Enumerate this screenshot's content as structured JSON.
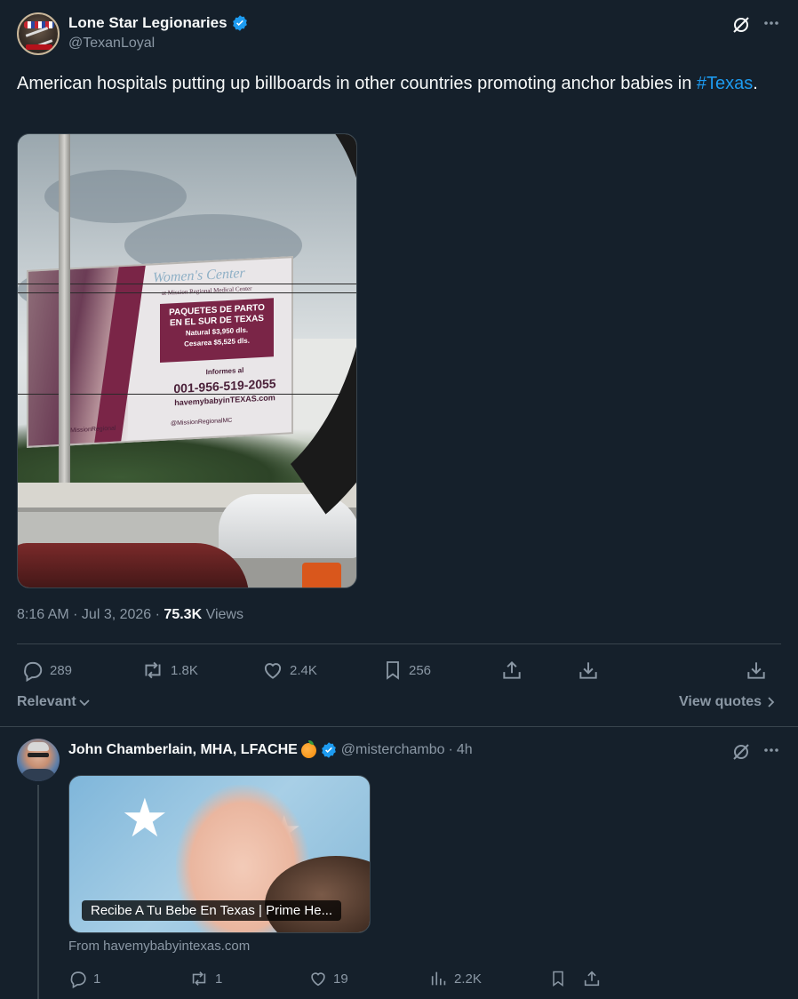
{
  "post": {
    "author_name": "Lone Star Legionaries",
    "author_handle": "@TexanLoyal",
    "text_before": "American hospitals putting up billboards in other countries promoting anchor babies in ",
    "hashtag": "#Texas",
    "text_after": ".",
    "photo": {
      "billboard_brand": "Women's Center",
      "billboard_sub": "at Mission Regional Medical Center",
      "billboard_box_line1": "PAQUETES DE PARTO",
      "billboard_box_line2": "EN EL SUR DE TEXAS",
      "billboard_natural": "Natural $3,950 dls.",
      "billboard_cesarea": "Cesarea $5,525 dls.",
      "billboard_informes": "Informes al",
      "billboard_phone": "001-956-519-2055",
      "billboard_url": "havemybabyinTEXAS.com",
      "billboard_social1": "@MissionRegional",
      "billboard_social2": "@MissionRegionalMC"
    },
    "time": "8:16 AM",
    "date": "Jul 3, 2026",
    "views_count": "75.3K",
    "views_label": "Views",
    "replies": "289",
    "reposts": "1.8K",
    "likes": "2.4K",
    "bookmarks": "256"
  },
  "filter": {
    "sort_label": "Relevant",
    "view_quotes": "View quotes"
  },
  "reply": {
    "author_name": "John Chamberlain, MHA, LFACHE",
    "author_handle": "@misterchambo",
    "time": "4h",
    "card_title": "Recibe A Tu Bebe En Texas | Prime He...",
    "card_source": "From havemybabyintexas.com",
    "replies": "1",
    "reposts": "1",
    "likes": "19",
    "views": "2.2K"
  },
  "colors": {
    "background": "#15202b",
    "accent": "#1d9bf0",
    "muted": "#8b98a5",
    "border": "#38444d"
  }
}
